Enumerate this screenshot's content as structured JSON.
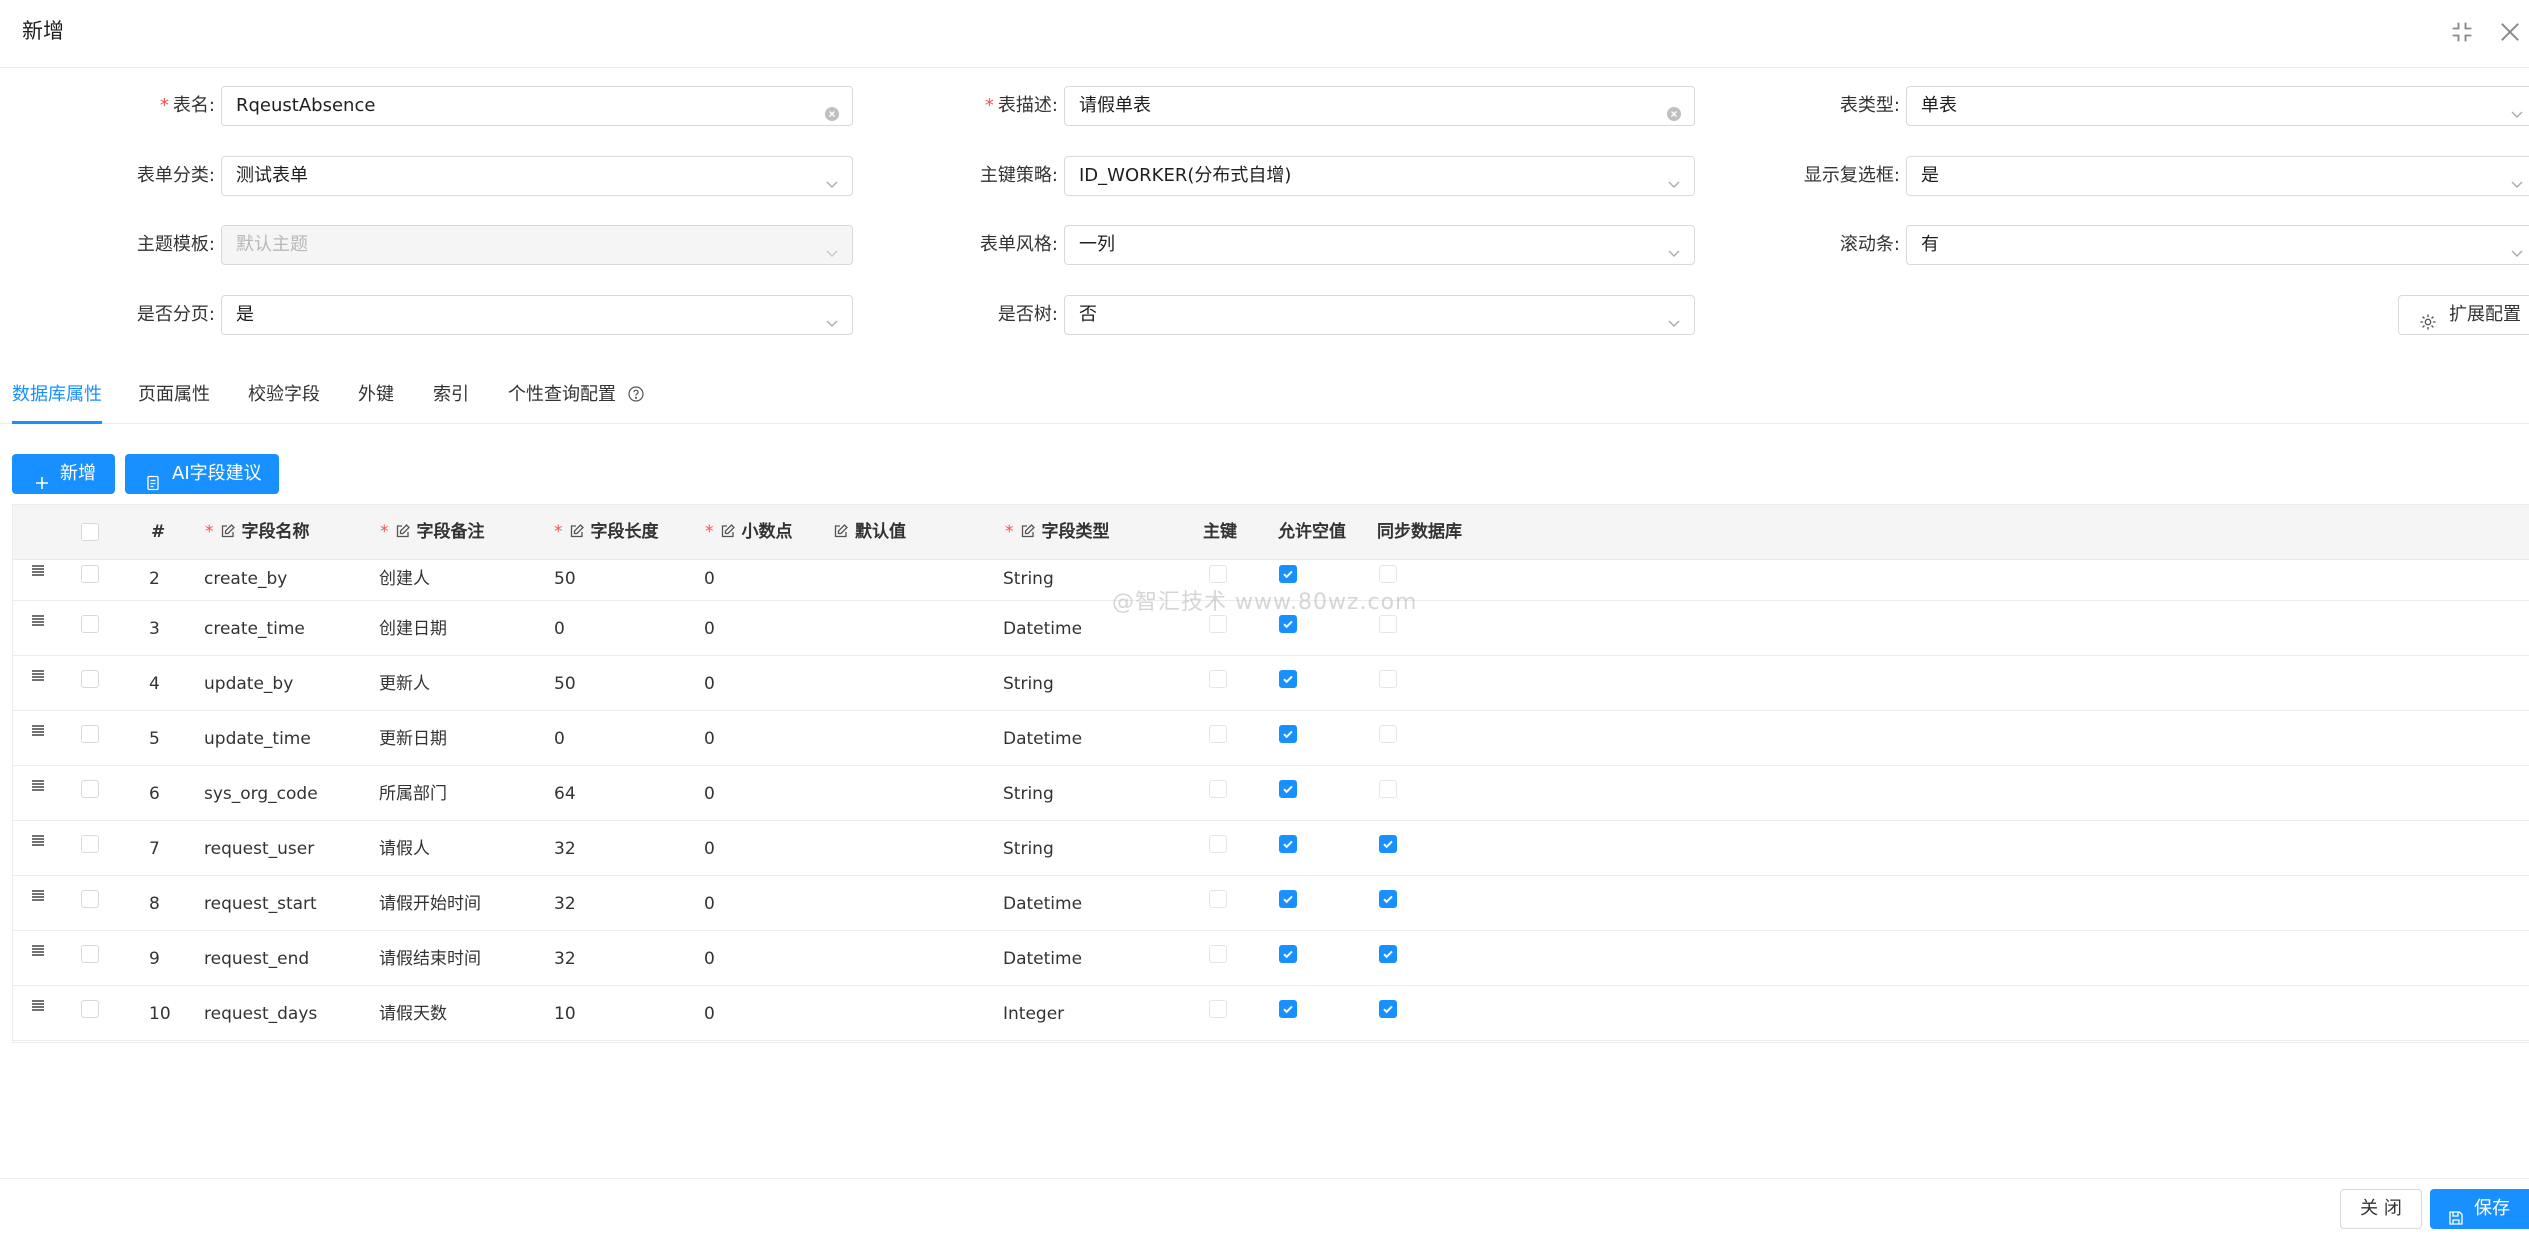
{
  "window": {
    "title": "新增"
  },
  "form": {
    "table_name": {
      "label": "表名:",
      "value": "RqeustAbsence"
    },
    "table_desc": {
      "label": "表描述:",
      "value": "请假单表"
    },
    "table_type": {
      "label": "表类型:",
      "value": "单表"
    },
    "form_category": {
      "label": "表单分类:",
      "value": "测试表单"
    },
    "pk_strategy": {
      "label": "主键策略:",
      "value": "ID_WORKER(分布式自增)"
    },
    "show_checkbox": {
      "label": "显示复选框:",
      "value": "是"
    },
    "theme_template": {
      "label": "主题模板:",
      "placeholder": "默认主题"
    },
    "form_style": {
      "label": "表单风格:",
      "value": "一列"
    },
    "scrollbar": {
      "label": "滚动条:",
      "value": "有"
    },
    "paginate": {
      "label": "是否分页:",
      "value": "是"
    },
    "is_tree": {
      "label": "是否树:",
      "value": "否"
    },
    "ext_config_label": "扩展配置"
  },
  "tabs": [
    {
      "label": "数据库属性",
      "active": true
    },
    {
      "label": "页面属性"
    },
    {
      "label": "校验字段"
    },
    {
      "label": "外键"
    },
    {
      "label": "索引"
    },
    {
      "label": "个性查询配置"
    }
  ],
  "toolbar": {
    "add_label": "新增",
    "ai_label": "AI字段建议"
  },
  "table": {
    "columns": {
      "index": "#",
      "field_name": "字段名称",
      "field_remark": "字段备注",
      "field_length": "字段长度",
      "decimal": "小数点",
      "default": "默认值",
      "field_type": "字段类型",
      "primary_key": "主键",
      "nullable": "允许空值",
      "sync_db": "同步数据库"
    },
    "rows": [
      {
        "index": "2",
        "name": "create_by",
        "remark": "创建人",
        "length": "50",
        "decimal": "0",
        "default": "",
        "type": "String",
        "primary_key": false,
        "nullable": true,
        "sync": false
      },
      {
        "index": "3",
        "name": "create_time",
        "remark": "创建日期",
        "length": "0",
        "decimal": "0",
        "default": "",
        "type": "Datetime",
        "primary_key": false,
        "nullable": true,
        "sync": false
      },
      {
        "index": "4",
        "name": "update_by",
        "remark": "更新人",
        "length": "50",
        "decimal": "0",
        "default": "",
        "type": "String",
        "primary_key": false,
        "nullable": true,
        "sync": false
      },
      {
        "index": "5",
        "name": "update_time",
        "remark": "更新日期",
        "length": "0",
        "decimal": "0",
        "default": "",
        "type": "Datetime",
        "primary_key": false,
        "nullable": true,
        "sync": false
      },
      {
        "index": "6",
        "name": "sys_org_code",
        "remark": "所属部门",
        "length": "64",
        "decimal": "0",
        "default": "",
        "type": "String",
        "primary_key": false,
        "nullable": true,
        "sync": false
      },
      {
        "index": "7",
        "name": "request_user",
        "remark": "请假人",
        "length": "32",
        "decimal": "0",
        "default": "",
        "type": "String",
        "primary_key": false,
        "nullable": true,
        "sync": true
      },
      {
        "index": "8",
        "name": "request_start",
        "remark": "请假开始时间",
        "length": "32",
        "decimal": "0",
        "default": "",
        "type": "Datetime",
        "primary_key": false,
        "nullable": true,
        "sync": true
      },
      {
        "index": "9",
        "name": "request_end",
        "remark": "请假结束时间",
        "length": "32",
        "decimal": "0",
        "default": "",
        "type": "Datetime",
        "primary_key": false,
        "nullable": true,
        "sync": true
      },
      {
        "index": "10",
        "name": "request_days",
        "remark": "请假天数",
        "length": "10",
        "decimal": "0",
        "default": "",
        "type": "Integer",
        "primary_key": false,
        "nullable": true,
        "sync": true
      }
    ]
  },
  "watermark": "@智汇技术 www.80wz.com",
  "footer": {
    "close_label": "关 闭",
    "save_label": "保存"
  },
  "colors": {
    "primary": "#1890ff",
    "required": "#ff4d4f"
  }
}
